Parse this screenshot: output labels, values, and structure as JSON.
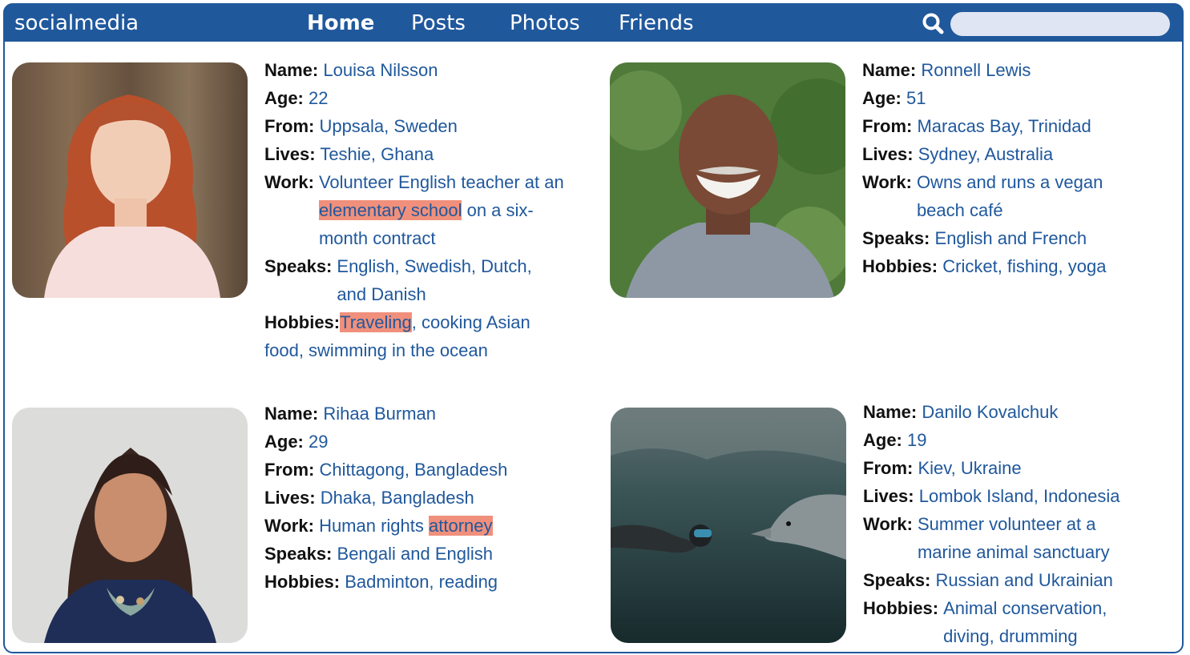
{
  "nav": {
    "brand": "socialmedia",
    "items": [
      {
        "label": "Home",
        "active": true
      },
      {
        "label": "Posts",
        "active": false
      },
      {
        "label": "Photos",
        "active": false
      },
      {
        "label": "Friends",
        "active": false
      }
    ],
    "search": {
      "placeholder": "",
      "value": ""
    }
  },
  "labels": {
    "name": "Name:",
    "age": "Age:",
    "from": "From:",
    "lives": "Lives:",
    "work": "Work:",
    "speaks": "Speaks:",
    "hobbies": "Hobbies:"
  },
  "profiles": [
    {
      "name": "Louisa Nilsson",
      "age": "22",
      "from": "Uppsala, Sweden",
      "lives": "Teshie, Ghana",
      "work_pre": "Volunteer English teacher at an ",
      "work_hl": "elementary school",
      "work_post": " on a six-month contract",
      "speaks": "English, Swedish, Dutch, and Danish",
      "hobbies_hl": "Traveling",
      "hobbies_post": ", cooking Asian food, swimming in the ocean"
    },
    {
      "name": "Ronnell Lewis",
      "age": "51",
      "from": "Maracas Bay, Trinidad",
      "lives": "Sydney, Australia",
      "work": "Owns and runs a vegan beach café",
      "speaks": "English and French",
      "hobbies": "Cricket, fishing, yoga"
    },
    {
      "name": "Rihaa Burman",
      "age": "29",
      "from": "Chittagong, Bangladesh",
      "lives": "Dhaka, Bangladesh",
      "work_pre": "Human rights ",
      "work_hl": "attorney",
      "speaks": "Bengali and English",
      "hobbies": "Badminton, reading"
    },
    {
      "name": "Danilo Kovalchuk",
      "age": "19",
      "from": "Kiev, Ukraine",
      "lives": "Lombok Island, Indonesia",
      "work": "Summer volunteer at a marine animal sanctuary",
      "speaks": "Russian and Ukrainian",
      "hobbies": "Animal conservation, diving, drumming"
    }
  ]
}
